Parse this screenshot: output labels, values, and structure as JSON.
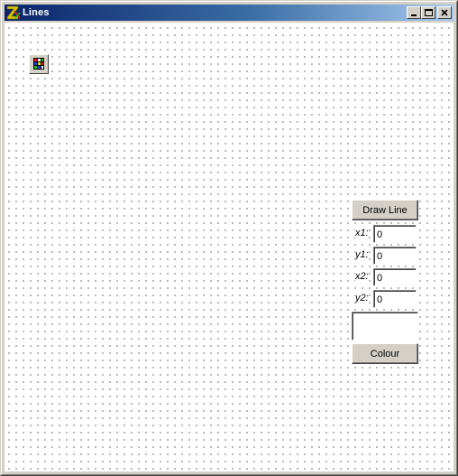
{
  "window": {
    "title": "Lines"
  },
  "icons": {
    "app": "lines-app-icon",
    "tool": "grid-tool-icon",
    "minimize": "minimize-icon",
    "maximize": "maximize-icon",
    "close": "close-icon"
  },
  "controls": {
    "draw_line_label": "Draw Line",
    "colour_label": "Colour",
    "fields": [
      {
        "label": "x1:",
        "value": "0"
      },
      {
        "label": "y1:",
        "value": "0"
      },
      {
        "label": "x2:",
        "value": "0"
      },
      {
        "label": "y2:",
        "value": "0"
      }
    ]
  },
  "colors": {
    "title_start": "#0a246a",
    "title_end": "#a6caf0",
    "face": "#d4d0c8",
    "canvas": "#ffffff",
    "selected_colour": "#ffffff"
  }
}
